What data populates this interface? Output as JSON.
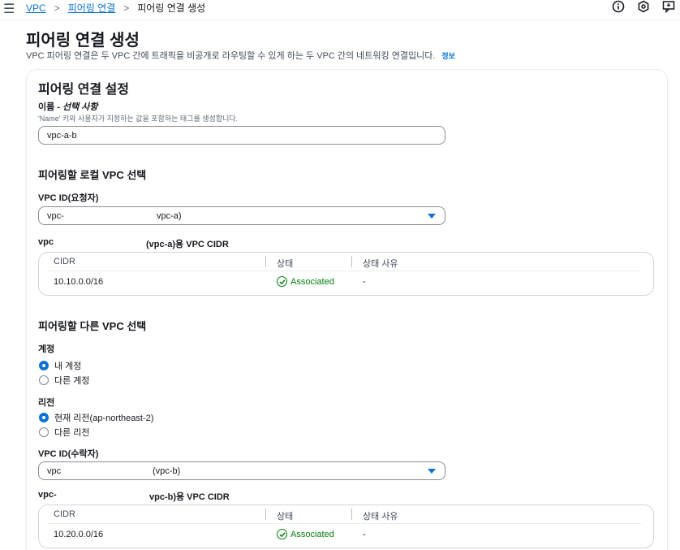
{
  "breadcrumb": {
    "item1": "VPC",
    "item2": "피어링 연결",
    "item3": "피어링 연결 생성",
    "separator": ">"
  },
  "top_icons": [
    "info-circle-icon",
    "hexagon-settings-icon",
    "feedback-icon"
  ],
  "page": {
    "title": "피어링 연결 생성",
    "description": "VPC 피어링 연결은 두 VPC 간에 트래픽을 비공개로 라우팅할 수 있게 하는 두 VPC 간의 네트워킹 연결입니다.",
    "info_link": "정보"
  },
  "settings": {
    "title": "피어링 연결 설정",
    "name_label": "이름 - ",
    "name_label_optional": "선택 사항",
    "name_hint": "'Name' 키와 사용자가 지정하는 값을 포함하는 태그를 생성합니다.",
    "name_value": "vpc-a-b"
  },
  "local_vpc": {
    "section_title": "피어링할 로컬 VPC 선택",
    "vpc_id_label": "VPC ID(요청자)",
    "select_prefix": "vpc-",
    "select_suffix": "vpc-a)",
    "cidr_title_prefix": "vpc",
    "cidr_title_suffix": "(vpc-a)용 VPC CIDR",
    "table": {
      "headers": [
        "CIDR",
        "상태",
        "상태 사유"
      ],
      "rows": [
        {
          "cidr": "10.10.0.0/16",
          "status": "Associated",
          "reason": "-"
        }
      ]
    }
  },
  "other_vpc": {
    "section_title": "피어링할 다른 VPC 선택",
    "account_label": "계정",
    "account_options": [
      "내 계정",
      "다른 계정"
    ],
    "account_selected": 0,
    "region_label": "리전",
    "region_options": [
      "현재 리전(ap-northeast-2)",
      "다른 리전"
    ],
    "region_selected": 0,
    "vpc_id_label": "VPC ID(수락자)",
    "select_prefix": "vpc",
    "select_suffix": "(vpc-b)",
    "cidr_title_prefix": "vpc-",
    "cidr_title_suffix": "vpc-b)용 VPC CIDR",
    "table": {
      "headers": [
        "CIDR",
        "상태",
        "상태 사유"
      ],
      "rows": [
        {
          "cidr": "10.20.0.0/16",
          "status": "Associated",
          "reason": "-"
        }
      ]
    }
  },
  "colors": {
    "link": "#0972d3",
    "success": "#037f0c",
    "border": "#8c8c94"
  }
}
